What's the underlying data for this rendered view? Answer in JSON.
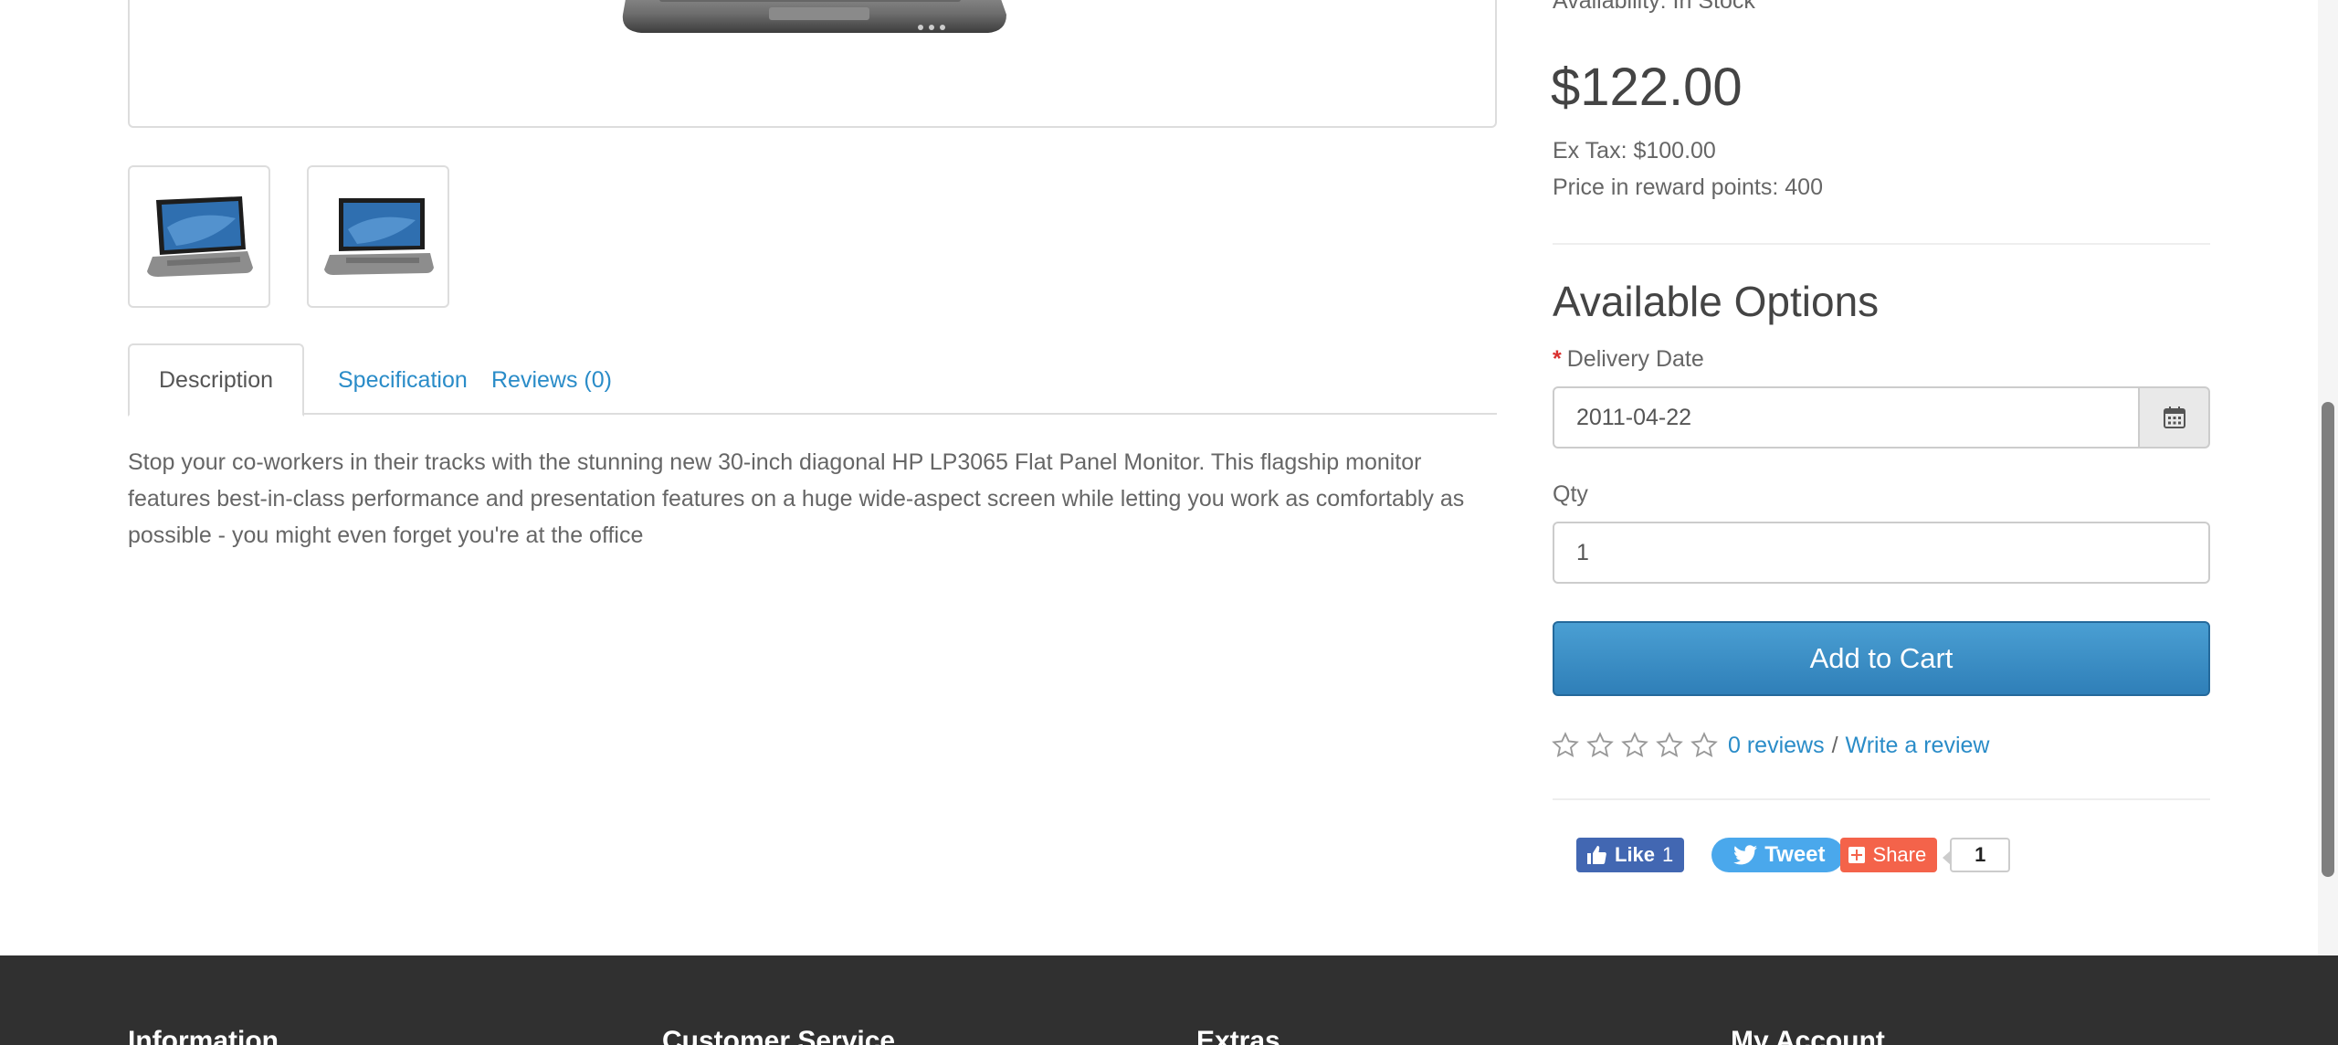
{
  "product": {
    "availability": "Availability: In Stock",
    "price": "$122.00",
    "ex_tax": "Ex Tax: $100.00",
    "reward_points": "Price in reward points: 400"
  },
  "tabs": [
    {
      "label": "Description"
    },
    {
      "label": "Specification"
    },
    {
      "label": "Reviews (0)"
    }
  ],
  "description": "Stop your co-workers in their tracks with the stunning new 30-inch diagonal HP LP3065 Flat Panel Monitor. This flagship monitor features best-in-class performance and presentation features on a huge wide-aspect screen while letting you work as comfortably as possible - you might even forget you're at the office",
  "options": {
    "title": "Available Options",
    "delivery_date_label": "Delivery Date",
    "required_marker": "*",
    "delivery_date_value": "2011-04-22",
    "qty_label": "Qty",
    "qty_value": "1"
  },
  "cart": {
    "button_label": "Add to Cart"
  },
  "rating": {
    "stars": 0,
    "reviews_link": "0 reviews",
    "separator": "/",
    "write_link": "Write a review"
  },
  "social": {
    "like_label": "Like",
    "like_count": "1",
    "tweet_label": "Tweet",
    "share_label": "Share",
    "share_count": "1"
  },
  "footer": {
    "headings": [
      "Information",
      "Customer Service",
      "Extras",
      "My Account"
    ]
  },
  "colors": {
    "link": "#2a8cc8",
    "button": "#3a8fc8",
    "required": "#d9312f",
    "footer_bg": "#303030",
    "facebook": "#4267b2",
    "twitter": "#4aa8ec",
    "share": "#f4634a"
  }
}
